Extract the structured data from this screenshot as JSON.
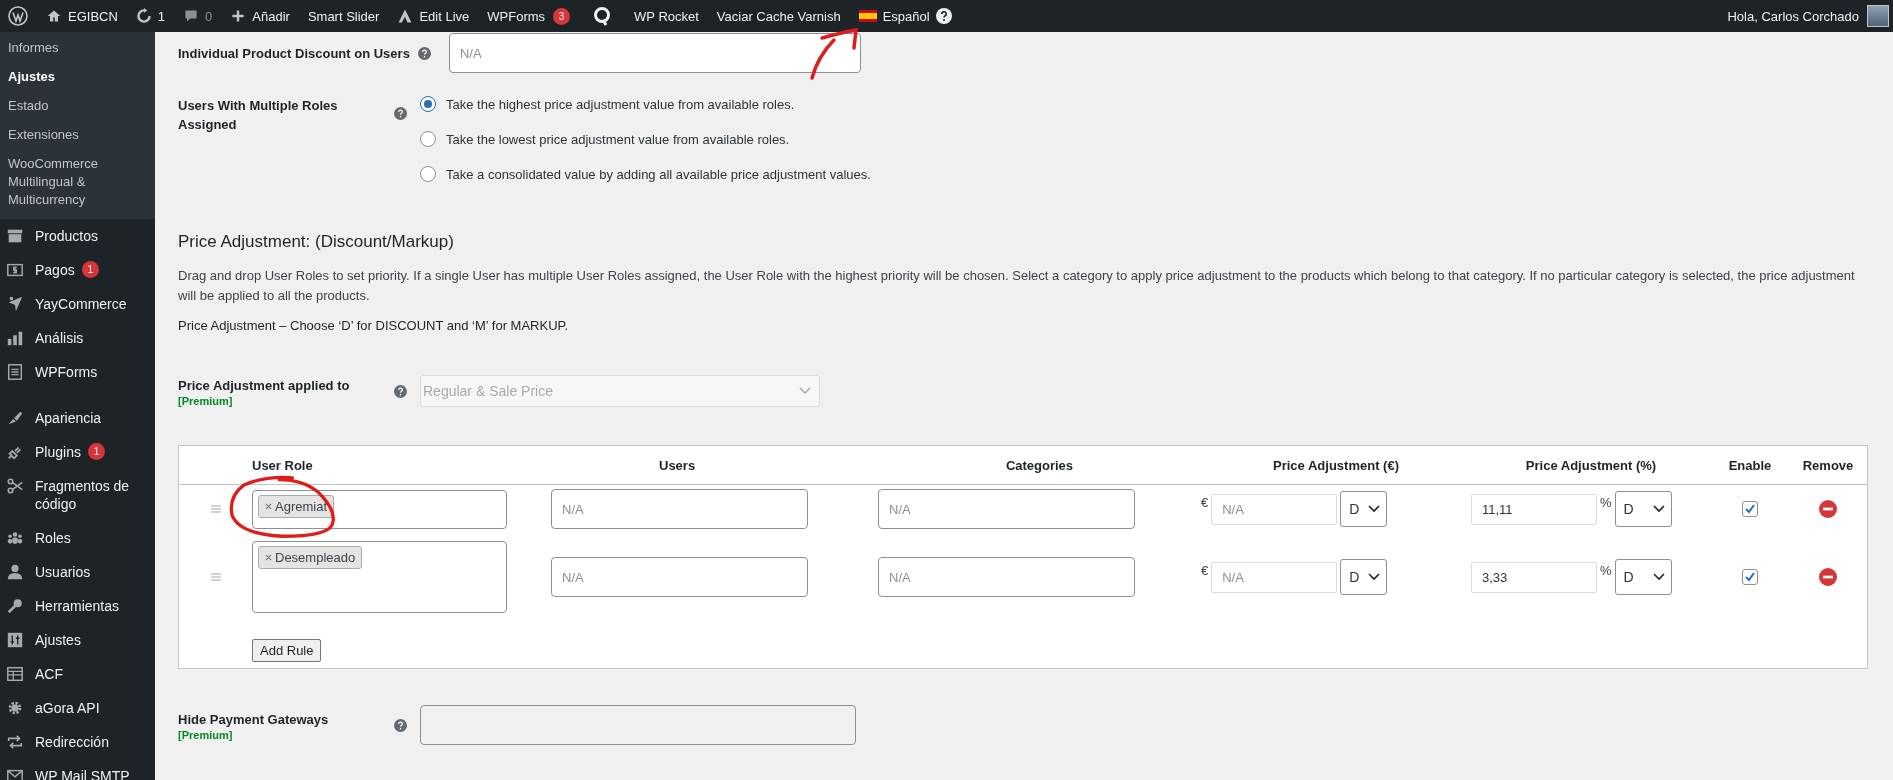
{
  "admin_bar": {
    "items": [
      {
        "kind": "logo"
      },
      {
        "kind": "home",
        "label": "EGIBCN"
      },
      {
        "kind": "updates",
        "label": "1"
      },
      {
        "kind": "comments",
        "label": "0"
      },
      {
        "kind": "new",
        "label": "Añadir"
      },
      {
        "kind": "text",
        "label": "Smart Slider"
      },
      {
        "kind": "edit-live",
        "label": "Edit Live"
      },
      {
        "kind": "badge",
        "label": "WPForms",
        "badge": "3"
      },
      {
        "kind": "q-logo"
      },
      {
        "kind": "text",
        "label": "WP Rocket"
      },
      {
        "kind": "text",
        "label": "Vaciar Cache Varnish"
      },
      {
        "kind": "language",
        "label": "Español"
      }
    ],
    "greeting": "Hola, Carlos Corchado"
  },
  "sidebar": {
    "submenu": [
      {
        "label": "Informes",
        "selected": false
      },
      {
        "label": "Ajustes",
        "selected": true
      },
      {
        "label": "Estado",
        "selected": false
      },
      {
        "label": "Extensiones",
        "selected": false
      },
      {
        "label": "WooCommerce Multilingual & Multicurrency",
        "selected": false
      }
    ],
    "menu_sections": [
      {
        "items": [
          {
            "label": "Productos",
            "kind": "box"
          },
          {
            "label": "Pagos",
            "kind": "dollar",
            "badge": "1"
          },
          {
            "label": "YayCommerce",
            "kind": "star"
          },
          {
            "label": "Análisis",
            "kind": "bars"
          },
          {
            "label": "WPForms",
            "kind": "form"
          }
        ]
      },
      {
        "items": [
          {
            "label": "Apariencia",
            "kind": "brush"
          },
          {
            "label": "Plugins",
            "kind": "plug",
            "badge": "1"
          },
          {
            "label": "Fragmentos de código",
            "kind": "scissors"
          },
          {
            "label": "Roles",
            "kind": "group"
          },
          {
            "label": "Usuarios",
            "kind": "person"
          },
          {
            "label": "Herramientas",
            "kind": "wrench"
          },
          {
            "label": "Ajustes",
            "kind": "sliders"
          },
          {
            "label": "ACF",
            "kind": "table"
          },
          {
            "label": "aGora API",
            "kind": "gear"
          },
          {
            "label": "Redirección",
            "kind": "arrows"
          },
          {
            "label": "WP Mail SMTP",
            "kind": "mail"
          }
        ]
      }
    ]
  },
  "individual_discount": {
    "label": "Individual Product Discount on Users",
    "placeholder": "N/A"
  },
  "multiple_roles": {
    "label": "Users With Multiple Roles Assigned",
    "options": [
      {
        "label": "Take the highest price adjustment value from available roles.",
        "selected": true
      },
      {
        "label": "Take the lowest price adjustment value from available roles.",
        "selected": false
      },
      {
        "label": "Take a consolidated value by adding all available price adjustment values.",
        "selected": false
      }
    ]
  },
  "price_adjustment": {
    "heading": "Price Adjustment: (Discount/Markup)",
    "description": "Drag and drop User Roles to set priority. If a single User has multiple User Roles assigned, the User Role with the highest priority will be chosen. Select a category to apply price adjustment to the products which belong to that category. If no particular category is selected, the price adjustment will be applied to all the products.",
    "note": "Price Adjustment – Choose ‘D’ for DISCOUNT and ‘M’ for MARKUP."
  },
  "applied_to": {
    "label": "Price Adjustment applied to",
    "tag": "[Premium]",
    "value": "Regular & Sale Price",
    "disabled": true
  },
  "table": {
    "columns": [
      "User Role",
      "Users",
      "Categories",
      "Price Adjustment (€)",
      "Price Adjustment (%)",
      "Enable",
      "Remove"
    ],
    "rows": [
      {
        "roles": [
          "Agremiat"
        ],
        "users_placeholder": "N/A",
        "categories_placeholder": "N/A",
        "currency_symbol": "€",
        "fixed_placeholder": "N/A",
        "fixed_type": "D",
        "percent_symbol": "%",
        "percent": "11,11",
        "percent_type": "D",
        "enabled": true
      },
      {
        "roles": [
          "Desempleado"
        ],
        "users_placeholder": "N/A",
        "categories_placeholder": "N/A",
        "currency_symbol": "€",
        "fixed_placeholder": "N/A",
        "fixed_type": "D",
        "percent_symbol": "%",
        "percent": "3,33",
        "percent_type": "D",
        "enabled": true
      }
    ],
    "add_button": "Add Rule"
  },
  "hide_gateways": {
    "label": "Hide Payment Gateways",
    "tag": "[Premium]",
    "disabled": true
  }
}
